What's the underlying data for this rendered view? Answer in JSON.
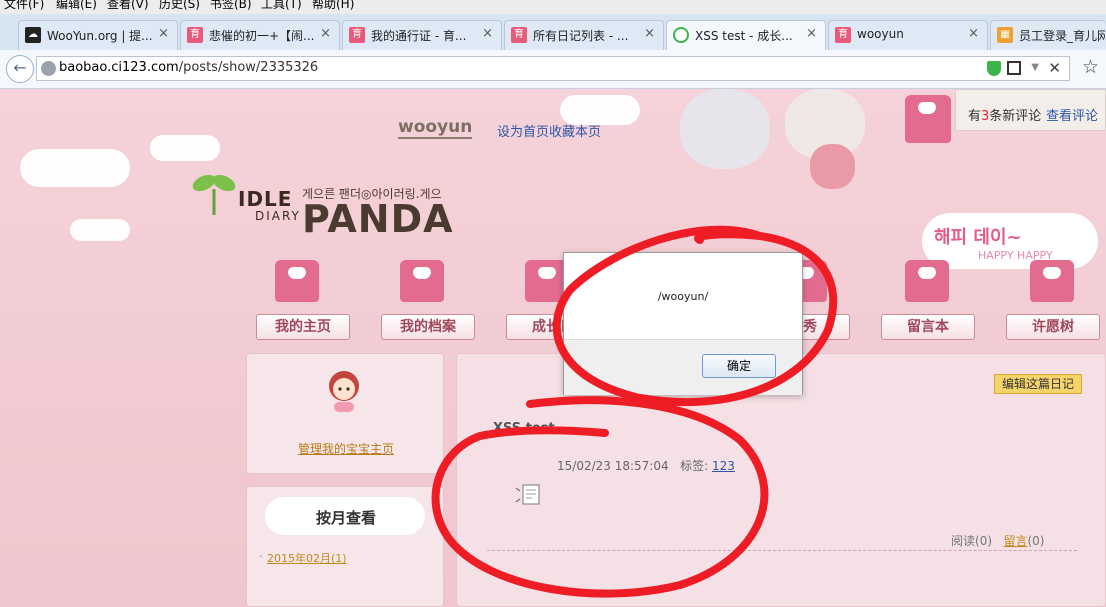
{
  "menu": [
    "文件(F)",
    "编辑(E)",
    "查看(V)",
    "历史(S)",
    "书签(B)",
    "工具(T)",
    "帮助(H)"
  ],
  "tabs": [
    {
      "title": "WooYun.org | 提...",
      "close": "×"
    },
    {
      "title": "悲催的初一+【闹...",
      "close": "×"
    },
    {
      "title": "我的通行证 - 育...",
      "close": "×"
    },
    {
      "title": "所有日记列表 - ...",
      "close": "×"
    },
    {
      "title": "XSS test - 成长...",
      "close": "×"
    },
    {
      "title": "wooyun",
      "close": "×"
    },
    {
      "title": "员工登录_育儿网",
      "close": ""
    }
  ],
  "address": {
    "host": "baobao.ci123.com",
    "path": "/posts/show/2335326"
  },
  "header": {
    "username": "wooyun",
    "set_home": "设为首页",
    "bookmark": "收藏本页",
    "notify_prefix": "有",
    "notify_count": "3",
    "notify_suffix": "条新评论",
    "notify_link": "查看评论"
  },
  "logo": {
    "idle": "IDLE",
    "diary": "DIARY",
    "panda": "PANDA",
    "korean": "게으른 팬더◎아이러링.게으"
  },
  "bubble": {
    "line1": "해피 데이~",
    "line2": "HAPPY HAPPY"
  },
  "nav": [
    "我的主页",
    "我的档案",
    "成长日",
    "晒秀",
    "留言本",
    "许愿树"
  ],
  "sidebar": {
    "manage_link": "管理我的宝宝主页",
    "month_title": "按月查看",
    "months": [
      "2015年02月(1)"
    ]
  },
  "post": {
    "edit_button": "编辑这篇日记",
    "title": "XSS test",
    "datetime": "15/02/23 18:57:04",
    "tag_label": "标签:",
    "tag": "123",
    "read_label": "阅读",
    "read_count": "(0)",
    "comment_label": "留言",
    "comment_count": "(0)"
  },
  "dialog": {
    "message": "/wooyun/",
    "ok": "确定"
  },
  "colors": {
    "page_bg": "#f2cfd5",
    "nav_text": "#a2485c",
    "link": "#2b56a8",
    "scribble": "#ee1c24"
  }
}
